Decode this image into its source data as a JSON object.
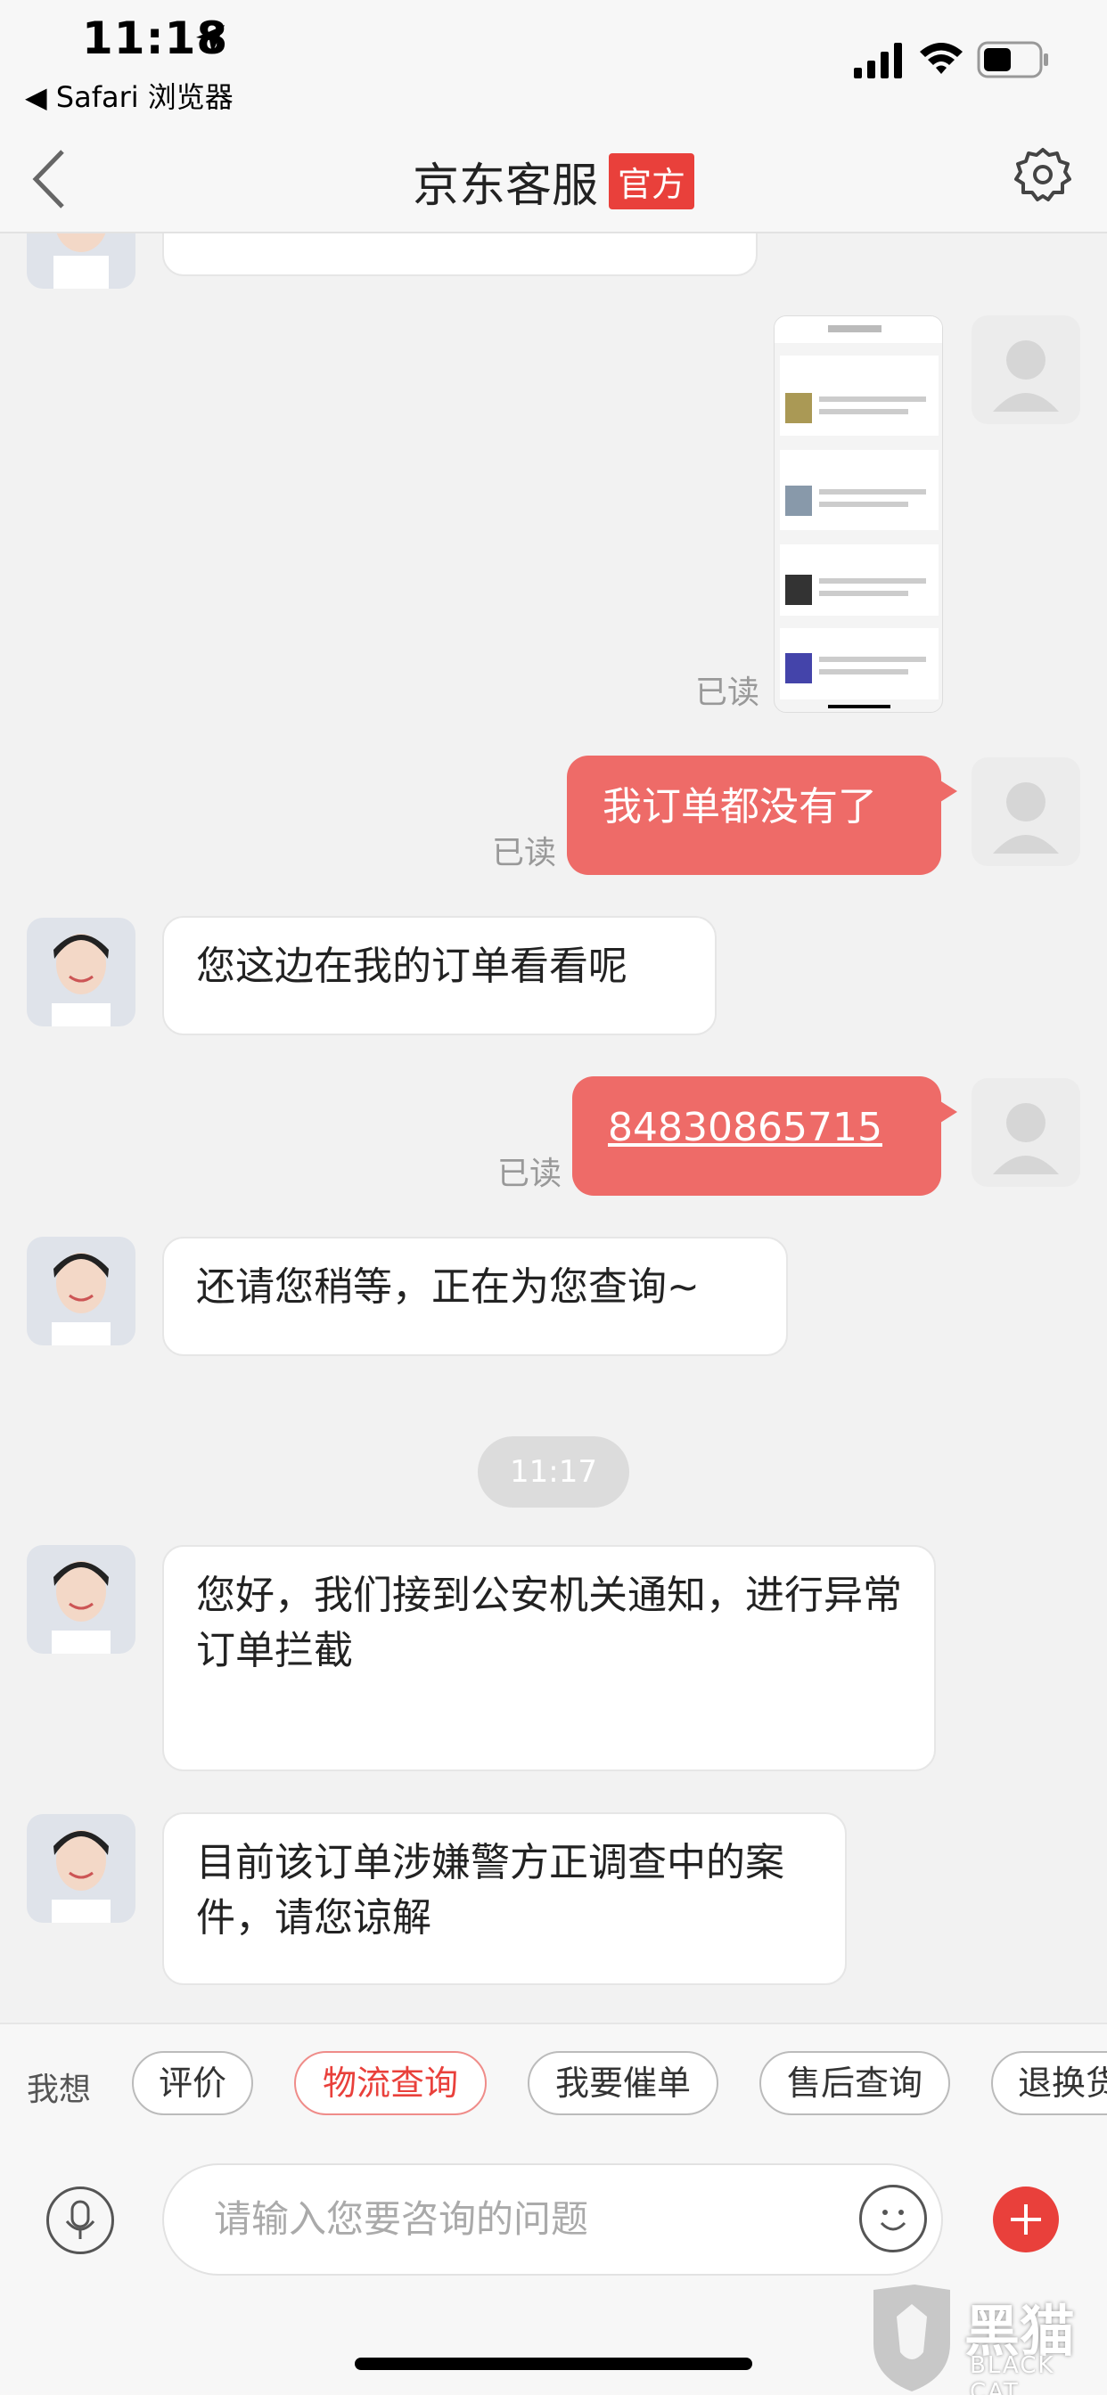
{
  "status_bar": {
    "time": "11:18",
    "back_app": "◀ Safari 浏览器"
  },
  "nav": {
    "title": "京东客服",
    "badge": "官方"
  },
  "messages": [
    {
      "text": "我订单都没有了",
      "read": "已读"
    },
    {
      "text": "您这边在我的订单看看呢"
    },
    {
      "text": "84830865715",
      "read": "已读"
    },
    {
      "text": "还请您稍等，正在为您查询~"
    },
    {
      "text": "您好，我们接到公安机关通知，进行异常订单拦截"
    },
    {
      "text": "目前该订单涉嫌警方正调查中的案件，请您谅解"
    }
  ],
  "screenshot_read": "已读",
  "time_divider": "11:17",
  "quick": {
    "label": "我想",
    "chips": [
      "评价",
      "物流查询",
      "我要催单",
      "售后查询",
      "退换货"
    ]
  },
  "input": {
    "placeholder": "请输入您要咨询的问题"
  },
  "watermark": {
    "text": "黑猫",
    "sub": "BLACK CAT"
  },
  "colors": {
    "brand_red": "#e9403b",
    "bubble_out": "#ee6b68"
  }
}
